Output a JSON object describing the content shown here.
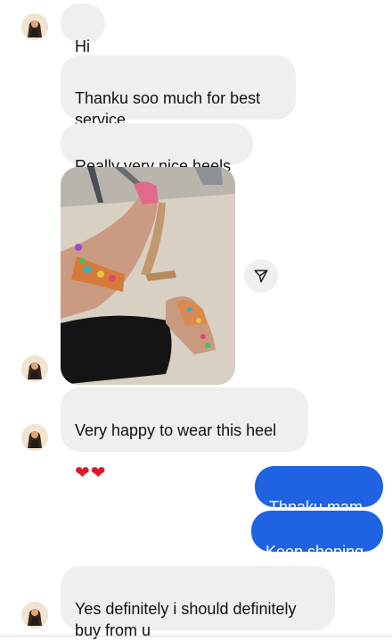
{
  "messages": {
    "m1": "Hi",
    "m2": "Thanku soo much for best\nservice",
    "m3": "Really very nice heels",
    "m4": "Very happy to wear this heel",
    "m4_emoji": [
      "red-heart",
      "red-heart"
    ],
    "m5": "Thnaku mam",
    "m6": "Keep shoping",
    "m7": "Yes definitely i should definitely\nbuy from u"
  },
  "photo_message": {
    "description_icon": "shared-photo",
    "share_icon": "paper-plane-icon"
  },
  "colors": {
    "incoming_bubble": "#efefef",
    "outgoing_bubble": "#1f63e2",
    "heart": "#e0162b"
  }
}
